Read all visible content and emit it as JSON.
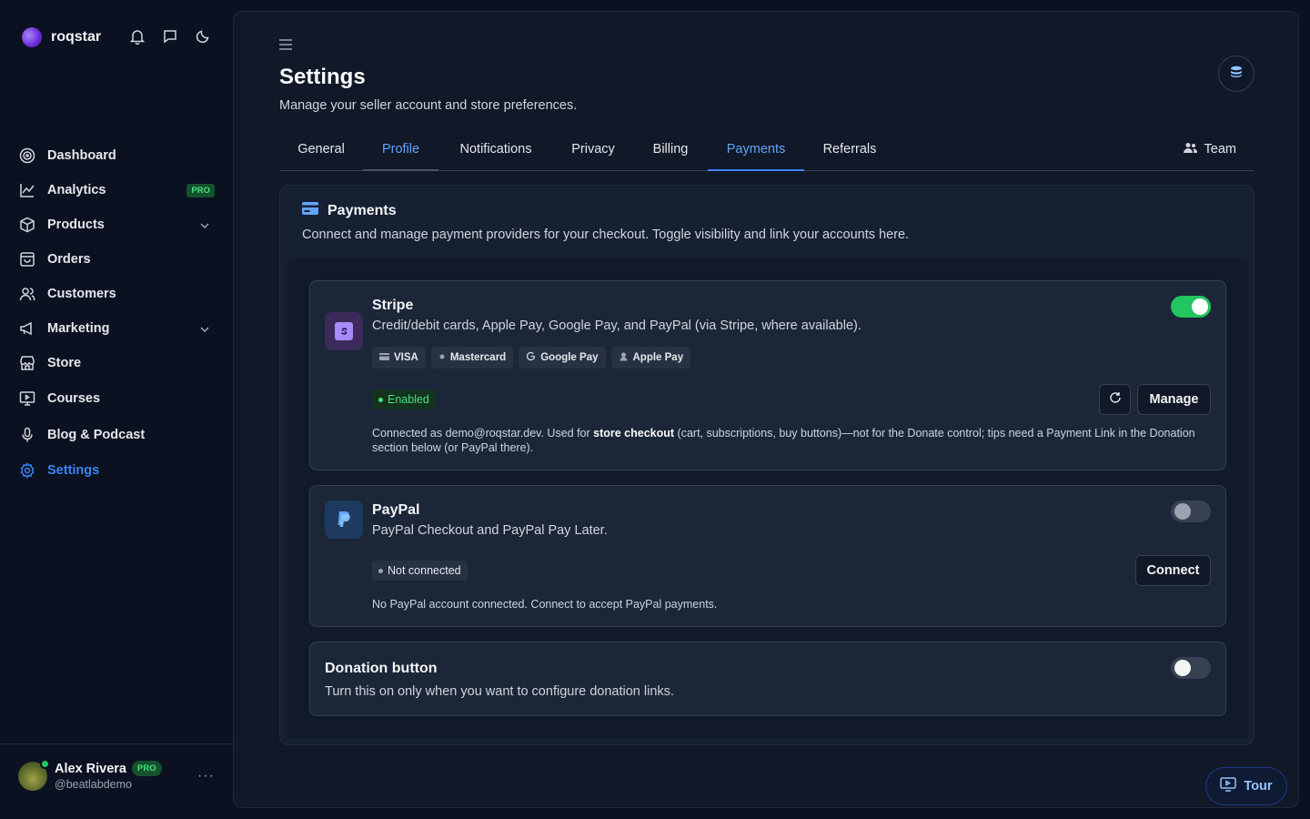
{
  "brand": {
    "name": "roqstar"
  },
  "sidebar": {
    "items": [
      {
        "label": "Dashboard",
        "icon": "dashboard-icon"
      },
      {
        "label": "Analytics",
        "icon": "chart-line-icon",
        "badge": "PRO"
      },
      {
        "label": "Products",
        "icon": "box-icon"
      },
      {
        "label": "Orders",
        "icon": "bag-icon"
      },
      {
        "label": "Customers",
        "icon": "users-icon"
      },
      {
        "label": "Marketing",
        "icon": "megaphone-icon"
      },
      {
        "label": "Store",
        "icon": "store-icon"
      },
      {
        "label": "Courses",
        "icon": "presentation-icon"
      },
      {
        "label": "Blog & Podcast",
        "icon": "mic-icon"
      },
      {
        "label": "Settings",
        "icon": "gear-icon"
      }
    ]
  },
  "user": {
    "name": "Alex Rivera",
    "badge": "PRO",
    "handle": "@beatlabdemo",
    "more": "···"
  },
  "page": {
    "title": "Settings",
    "subtitle": "Manage your seller account and store preferences."
  },
  "tabs": [
    "General",
    "Profile",
    "Notifications",
    "Privacy",
    "Billing",
    "Payments",
    "Referrals"
  ],
  "team_label": "Team",
  "payments": {
    "title": "Payments",
    "description": "Connect and manage payment providers for your checkout. Toggle visibility and link your accounts here.",
    "stripe": {
      "title": "Stripe",
      "description": "Credit/debit cards, Apple Pay, Google Pay, and PayPal (via Stripe, where available).",
      "enabled": true,
      "methods": [
        "VISA",
        "Mastercard",
        "Google Pay",
        "Apple Pay"
      ],
      "status": "Enabled",
      "manage_label": "Manage",
      "note_1": "Connected as demo@roqstar.dev. Used for ",
      "note_bold": "store checkout",
      "note_2": " (cart, subscriptions, buy buttons)—not for the Donate control; tips need a Payment Link in the Donation section below (or PayPal there)."
    },
    "paypal": {
      "title": "PayPal",
      "description": "PayPal Checkout and PayPal Pay Later.",
      "enabled": false,
      "status": "Not connected",
      "connect_label": "Connect",
      "note": "No PayPal account connected. Connect to accept PayPal payments."
    },
    "donation": {
      "title": "Donation button",
      "description": "Turn this on only when you want to configure donation links.",
      "enabled": false
    }
  },
  "tour_label": "Tour",
  "colors": {
    "accent": "#3b82f6",
    "success": "#22c55e",
    "background": "#0b1120",
    "panel": "#111827"
  }
}
